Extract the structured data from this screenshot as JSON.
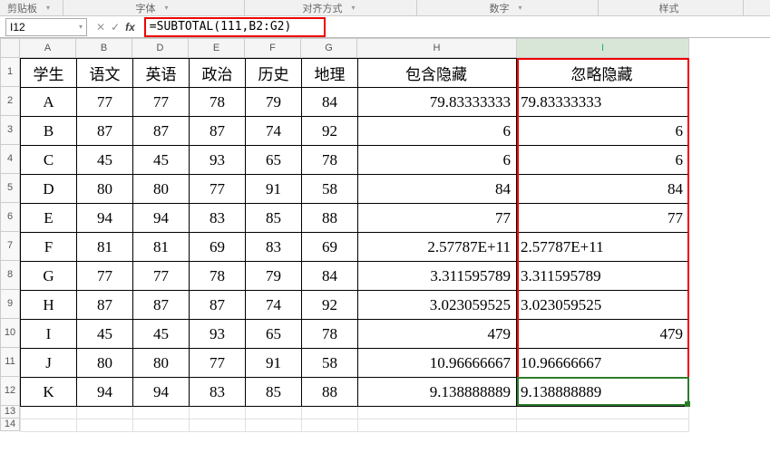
{
  "ribbon": {
    "clipboard": "剪贴板",
    "font": "字体",
    "alignment": "对齐方式",
    "number": "数字",
    "styles": "样式"
  },
  "name_box": "I12",
  "formula": "=SUBTOTAL(111,B2:G2)",
  "col_labels": [
    "A",
    "B",
    "D",
    "E",
    "F",
    "G",
    "H",
    "I"
  ],
  "row_labels": [
    "1",
    "2",
    "3",
    "4",
    "5",
    "6",
    "7",
    "8",
    "9",
    "10",
    "11",
    "12",
    "13",
    "14"
  ],
  "headers": [
    "学生",
    "语文",
    "英语",
    "政治",
    "历史",
    "地理",
    "包含隐藏",
    "忽略隐藏"
  ],
  "rows": [
    [
      "A",
      "77",
      "77",
      "78",
      "79",
      "84",
      "79.83333333",
      "79.83333333"
    ],
    [
      "B",
      "87",
      "87",
      "87",
      "74",
      "92",
      "6",
      "6"
    ],
    [
      "C",
      "45",
      "45",
      "93",
      "65",
      "78",
      "6",
      "6"
    ],
    [
      "D",
      "80",
      "80",
      "77",
      "91",
      "58",
      "84",
      "84"
    ],
    [
      "E",
      "94",
      "94",
      "83",
      "85",
      "88",
      "77",
      "77"
    ],
    [
      "F",
      "81",
      "81",
      "69",
      "83",
      "69",
      "2.57787E+11",
      "2.57787E+11"
    ],
    [
      "G",
      "77",
      "77",
      "78",
      "79",
      "84",
      "3.311595789",
      "3.311595789"
    ],
    [
      "H",
      "87",
      "87",
      "87",
      "74",
      "92",
      "3.023059525",
      "3.023059525"
    ],
    [
      "I",
      "45",
      "45",
      "93",
      "65",
      "78",
      "479",
      "479"
    ],
    [
      "J",
      "80",
      "80",
      "77",
      "91",
      "58",
      "10.96666667",
      "10.96666667"
    ],
    [
      "K",
      "94",
      "94",
      "83",
      "85",
      "88",
      "9.138888889",
      "9.138888889"
    ]
  ],
  "chart_data": {
    "type": "table",
    "columns": [
      "学生",
      "语文",
      "英语",
      "政治",
      "历史",
      "地理",
      "包含隐藏",
      "忽略隐藏"
    ],
    "data": [
      {
        "学生": "A",
        "语文": 77,
        "英语": 77,
        "政治": 78,
        "历史": 79,
        "地理": 84,
        "包含隐藏": 79.83333333,
        "忽略隐藏": 79.83333333
      },
      {
        "学生": "B",
        "语文": 87,
        "英语": 87,
        "政治": 87,
        "历史": 74,
        "地理": 92,
        "包含隐藏": 6,
        "忽略隐藏": 6
      },
      {
        "学生": "C",
        "语文": 45,
        "英语": 45,
        "政治": 93,
        "历史": 65,
        "地理": 78,
        "包含隐藏": 6,
        "忽略隐藏": 6
      },
      {
        "学生": "D",
        "语文": 80,
        "英语": 80,
        "政治": 77,
        "历史": 91,
        "地理": 58,
        "包含隐藏": 84,
        "忽略隐藏": 84
      },
      {
        "学生": "E",
        "语文": 94,
        "英语": 94,
        "政治": 83,
        "历史": 85,
        "地理": 88,
        "包含隐藏": 77,
        "忽略隐藏": 77
      },
      {
        "学生": "F",
        "语文": 81,
        "英语": 81,
        "政治": 69,
        "历史": 83,
        "地理": 69,
        "包含隐藏": 257787000000,
        "忽略隐藏": 257787000000
      },
      {
        "学生": "G",
        "语文": 77,
        "英语": 77,
        "政治": 78,
        "历史": 79,
        "地理": 84,
        "包含隐藏": 3.311595789,
        "忽略隐藏": 3.311595789
      },
      {
        "学生": "H",
        "语文": 87,
        "英语": 87,
        "政治": 87,
        "历史": 74,
        "地理": 92,
        "包含隐藏": 3.023059525,
        "忽略隐藏": 3.023059525
      },
      {
        "学生": "I",
        "语文": 45,
        "英语": 45,
        "政治": 93,
        "历史": 65,
        "地理": 78,
        "包含隐藏": 479,
        "忽略隐藏": 479
      },
      {
        "学生": "J",
        "语文": 80,
        "英语": 80,
        "政治": 77,
        "历史": 91,
        "地理": 58,
        "包含隐藏": 10.96666667,
        "忽略隐藏": 10.96666667
      },
      {
        "学生": "K",
        "语文": 94,
        "英语": 94,
        "政治": 83,
        "历史": 85,
        "地理": 88,
        "包含隐藏": 9.138888889,
        "忽略隐藏": 9.138888889
      }
    ]
  }
}
